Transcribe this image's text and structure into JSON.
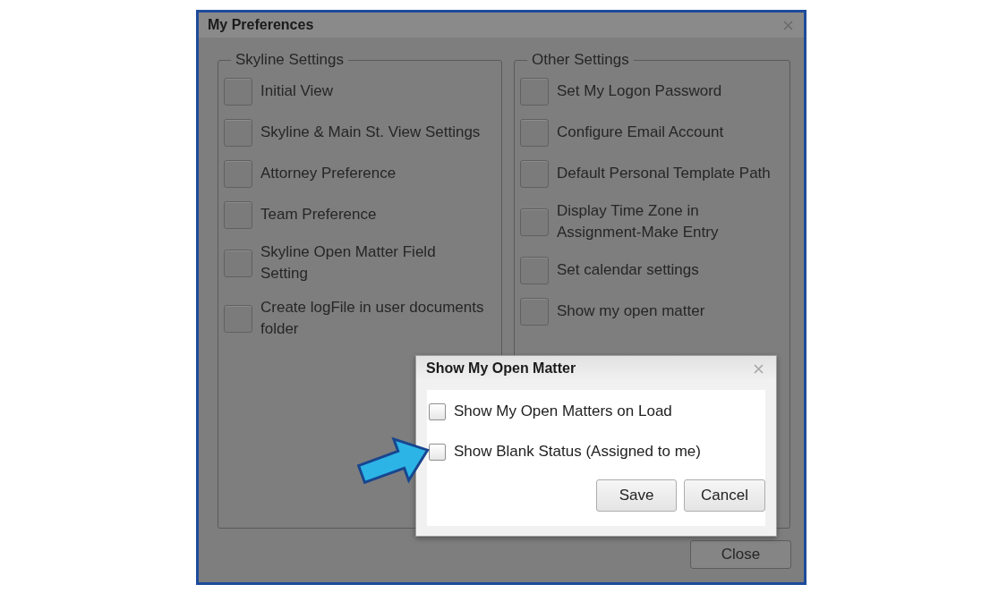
{
  "window": {
    "title": "My Preferences"
  },
  "groups": [
    {
      "title": "Skyline Settings",
      "items": [
        "Initial View",
        "Skyline & Main St. View Settings",
        "Attorney Preference",
        "Team Preference",
        "Skyline Open Matter Field Setting",
        "Create logFile in user documents folder"
      ]
    },
    {
      "title": "Other Settings",
      "items": [
        "Set My Logon Password",
        "Configure Email Account",
        "Default Personal Template Path",
        "Display Time Zone in Assignment-Make Entry",
        "Set calendar settings",
        "Show my open matter"
      ]
    }
  ],
  "close_button": "Close",
  "dialog": {
    "title": "Show My Open Matter",
    "options": [
      {
        "label": "Show My Open Matters on Load",
        "checked": false
      },
      {
        "label": "Show Blank Status (Assigned to me)",
        "checked": false
      }
    ],
    "buttons": [
      "Save",
      "Cancel"
    ]
  }
}
